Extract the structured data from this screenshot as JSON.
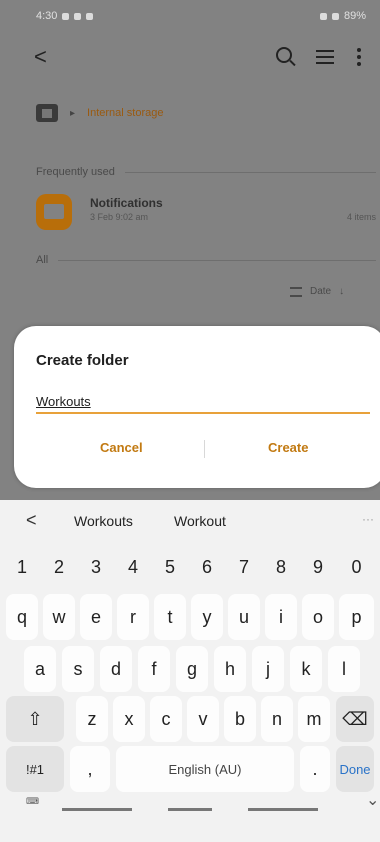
{
  "status": {
    "time": "4:30",
    "battery": "89%"
  },
  "toolbar": {
    "back_label": "<"
  },
  "breadcrumb": {
    "arrow": "▸",
    "path": "Internal storage"
  },
  "sections": {
    "frequent": "Frequently used",
    "all": "All"
  },
  "recent": {
    "name": "Notifications",
    "date": "3 Feb 9:02 am",
    "count": "4 items"
  },
  "sort": {
    "label": "Date",
    "direction": "↓"
  },
  "dialog": {
    "title": "Create folder",
    "input_value": "Workouts",
    "cancel_label": "Cancel",
    "create_label": "Create",
    "accent": "#c27a12"
  },
  "keyboard": {
    "suggest_back": "<",
    "suggestions": [
      "Workouts",
      "Workout"
    ],
    "suggest_more": "···",
    "numbers": [
      "1",
      "2",
      "3",
      "4",
      "5",
      "6",
      "7",
      "8",
      "9",
      "0"
    ],
    "row1": [
      "q",
      "w",
      "e",
      "r",
      "t",
      "y",
      "u",
      "i",
      "o",
      "p"
    ],
    "row2": [
      "a",
      "s",
      "d",
      "f",
      "g",
      "h",
      "j",
      "k",
      "l"
    ],
    "row3": [
      "z",
      "x",
      "c",
      "v",
      "b",
      "n",
      "m"
    ],
    "shift": "⇧",
    "backspace": "⌫",
    "symbols": "!#1",
    "comma": ",",
    "space": "English (AU)",
    "period": ".",
    "done": "Done"
  },
  "navbar": {
    "keyboard_icon": "⌨",
    "chevron": "⌄"
  }
}
